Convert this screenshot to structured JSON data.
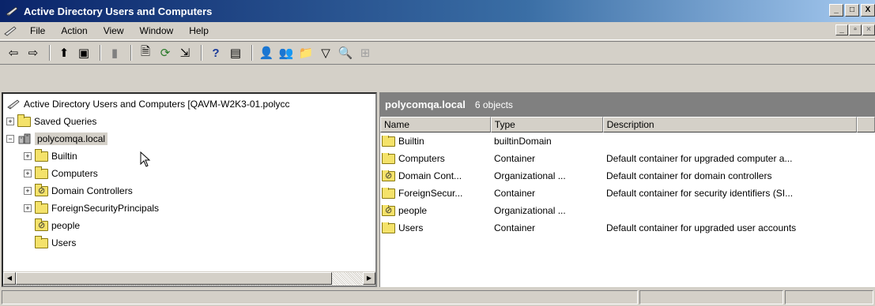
{
  "window": {
    "title": "Active Directory Users and Computers",
    "title_buttons": [
      "_",
      "□",
      "X"
    ],
    "mdi_buttons": [
      "_",
      "▫",
      "×"
    ]
  },
  "menu": {
    "items": [
      {
        "label": "File"
      },
      {
        "label": "Action"
      },
      {
        "label": "View"
      },
      {
        "label": "Window"
      },
      {
        "label": "Help"
      }
    ]
  },
  "toolbar": {
    "buttons": [
      {
        "icon": "back-arrow-icon",
        "glyph": "⇦"
      },
      {
        "icon": "forward-arrow-icon",
        "glyph": "⇨"
      },
      {
        "icon": "up-one-level-icon",
        "glyph": "⬆"
      },
      {
        "icon": "show-hide-console-tree-icon",
        "glyph": "▣"
      },
      {
        "icon": "delete-icon",
        "glyph": "▮"
      },
      {
        "icon": "properties-icon",
        "glyph": "🗎"
      },
      {
        "icon": "refresh-icon",
        "glyph": "⟳"
      },
      {
        "icon": "export-list-icon",
        "glyph": "⇲"
      },
      {
        "icon": "help-icon",
        "glyph": "?"
      },
      {
        "icon": "show-hide-action-pane-icon",
        "glyph": "▤"
      },
      {
        "icon": "new-user-icon",
        "glyph": "👤"
      },
      {
        "icon": "new-group-icon",
        "glyph": "👥"
      },
      {
        "icon": "new-ou-icon",
        "glyph": "📁"
      },
      {
        "icon": "filter-icon",
        "glyph": "▽"
      },
      {
        "icon": "find-icon",
        "glyph": "🔍"
      },
      {
        "icon": "add-to-group-icon",
        "glyph": "⊞"
      }
    ]
  },
  "tree": {
    "root": {
      "label": "Active Directory Users and Computers [QAVM-W2K3-01.polycc",
      "icon": "ad-root-icon"
    },
    "items": [
      {
        "label": "Saved Queries",
        "expander": "+",
        "icon": "folder-icon",
        "level": 1
      },
      {
        "label": "polycomqa.local",
        "expander": "−",
        "icon": "domain-icon",
        "level": 1,
        "selected": true
      },
      {
        "label": "Builtin",
        "expander": "+",
        "icon": "folder-icon",
        "level": 2
      },
      {
        "label": "Computers",
        "expander": "+",
        "icon": "folder-icon",
        "level": 2
      },
      {
        "label": "Domain Controllers",
        "expander": "+",
        "icon": "ou-folder-icon",
        "level": 2
      },
      {
        "label": "ForeignSecurityPrincipals",
        "expander": "+",
        "icon": "folder-icon",
        "level": 2
      },
      {
        "label": "people",
        "expander": "",
        "icon": "ou-folder-icon",
        "level": 2
      },
      {
        "label": "Users",
        "expander": "",
        "icon": "folder-icon",
        "level": 2
      }
    ]
  },
  "details": {
    "scope": "polycomqa.local",
    "count": "6 objects",
    "columns": [
      "Name",
      "Type",
      "Description"
    ],
    "rows": [
      {
        "name": "Builtin",
        "type": "builtinDomain",
        "description": "",
        "icon": "folder-icon"
      },
      {
        "name": "Computers",
        "type": "Container",
        "description": "Default container for upgraded computer a...",
        "icon": "folder-icon"
      },
      {
        "name": "Domain Cont...",
        "type": "Organizational ...",
        "description": "Default container for domain controllers",
        "icon": "ou-folder-icon"
      },
      {
        "name": "ForeignSecur...",
        "type": "Container",
        "description": "Default container for security identifiers (SI...",
        "icon": "folder-icon"
      },
      {
        "name": "people",
        "type": "Organizational ...",
        "description": "",
        "icon": "ou-folder-icon"
      },
      {
        "name": "Users",
        "type": "Container",
        "description": "Default container for upgraded user accounts",
        "icon": "folder-icon"
      }
    ]
  }
}
